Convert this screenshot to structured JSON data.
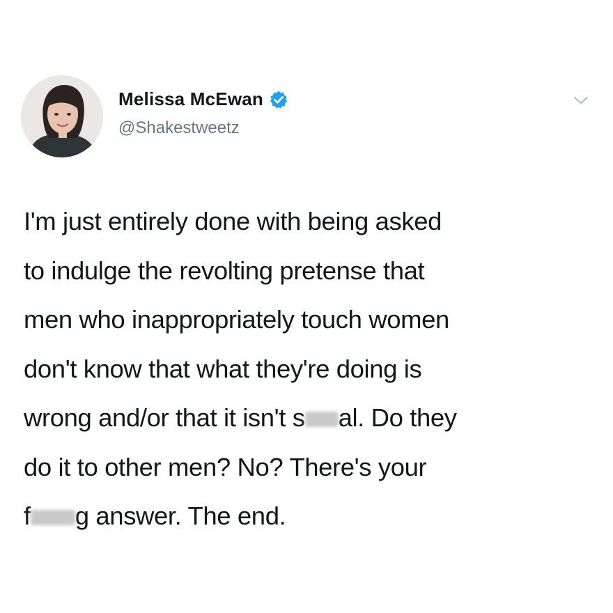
{
  "tweet": {
    "display_name": "Melissa McEwan",
    "handle": "@Shakestweetz",
    "verified_icon": "verified-badge-icon",
    "menu_icon": "chevron-down-icon",
    "accent_color": "#1da1f2",
    "text_lines": [
      {
        "a": "I'm just entirely done with being asked"
      },
      {
        "a": "to indulge the revolting pretense that"
      },
      {
        "a": "men who inappropriately touch women"
      },
      {
        "a": "don't know that what they're doing is"
      },
      {
        "a": "wrong and/or that it isn't s",
        "b": "al. Do they"
      },
      {
        "a": "do it to other men? No? There's your"
      },
      {
        "a": "f",
        "b": "g answer. The end."
      }
    ]
  }
}
